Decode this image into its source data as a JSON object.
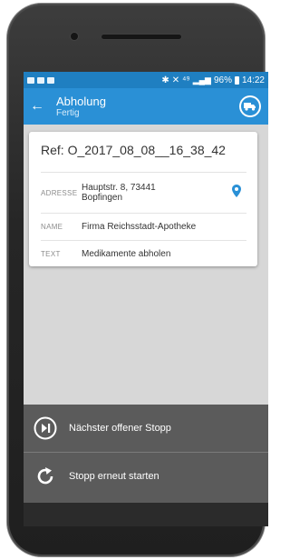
{
  "statusbar": {
    "signal_text": "⁴⁹",
    "battery": "96%",
    "time": "14:22"
  },
  "appbar": {
    "back_icon": "arrow-left-icon",
    "title": "Abholung",
    "subtitle": "Fertig",
    "truck_icon": "truck-icon"
  },
  "card": {
    "ref": "Ref: O_2017_08_08__16_38_42",
    "rows": [
      {
        "label": "Adresse",
        "value_line1": "Hauptstr. 8, 73441",
        "value_line2": "Bopfingen",
        "icon": "location-pin-icon"
      },
      {
        "label": "Name",
        "value": "Firma Reichsstadt-Apotheke"
      },
      {
        "label": "Text",
        "value": "Medikamente abholen"
      }
    ]
  },
  "actions": [
    {
      "label": "Nächster offener Stopp",
      "icon": "skip-next-icon"
    },
    {
      "label": "Stopp erneut starten",
      "icon": "restart-icon"
    }
  ],
  "colors": {
    "primary": "#2a90d6",
    "statusbar": "#1f7fc1",
    "bottom_panel": "#5b5b5b"
  }
}
